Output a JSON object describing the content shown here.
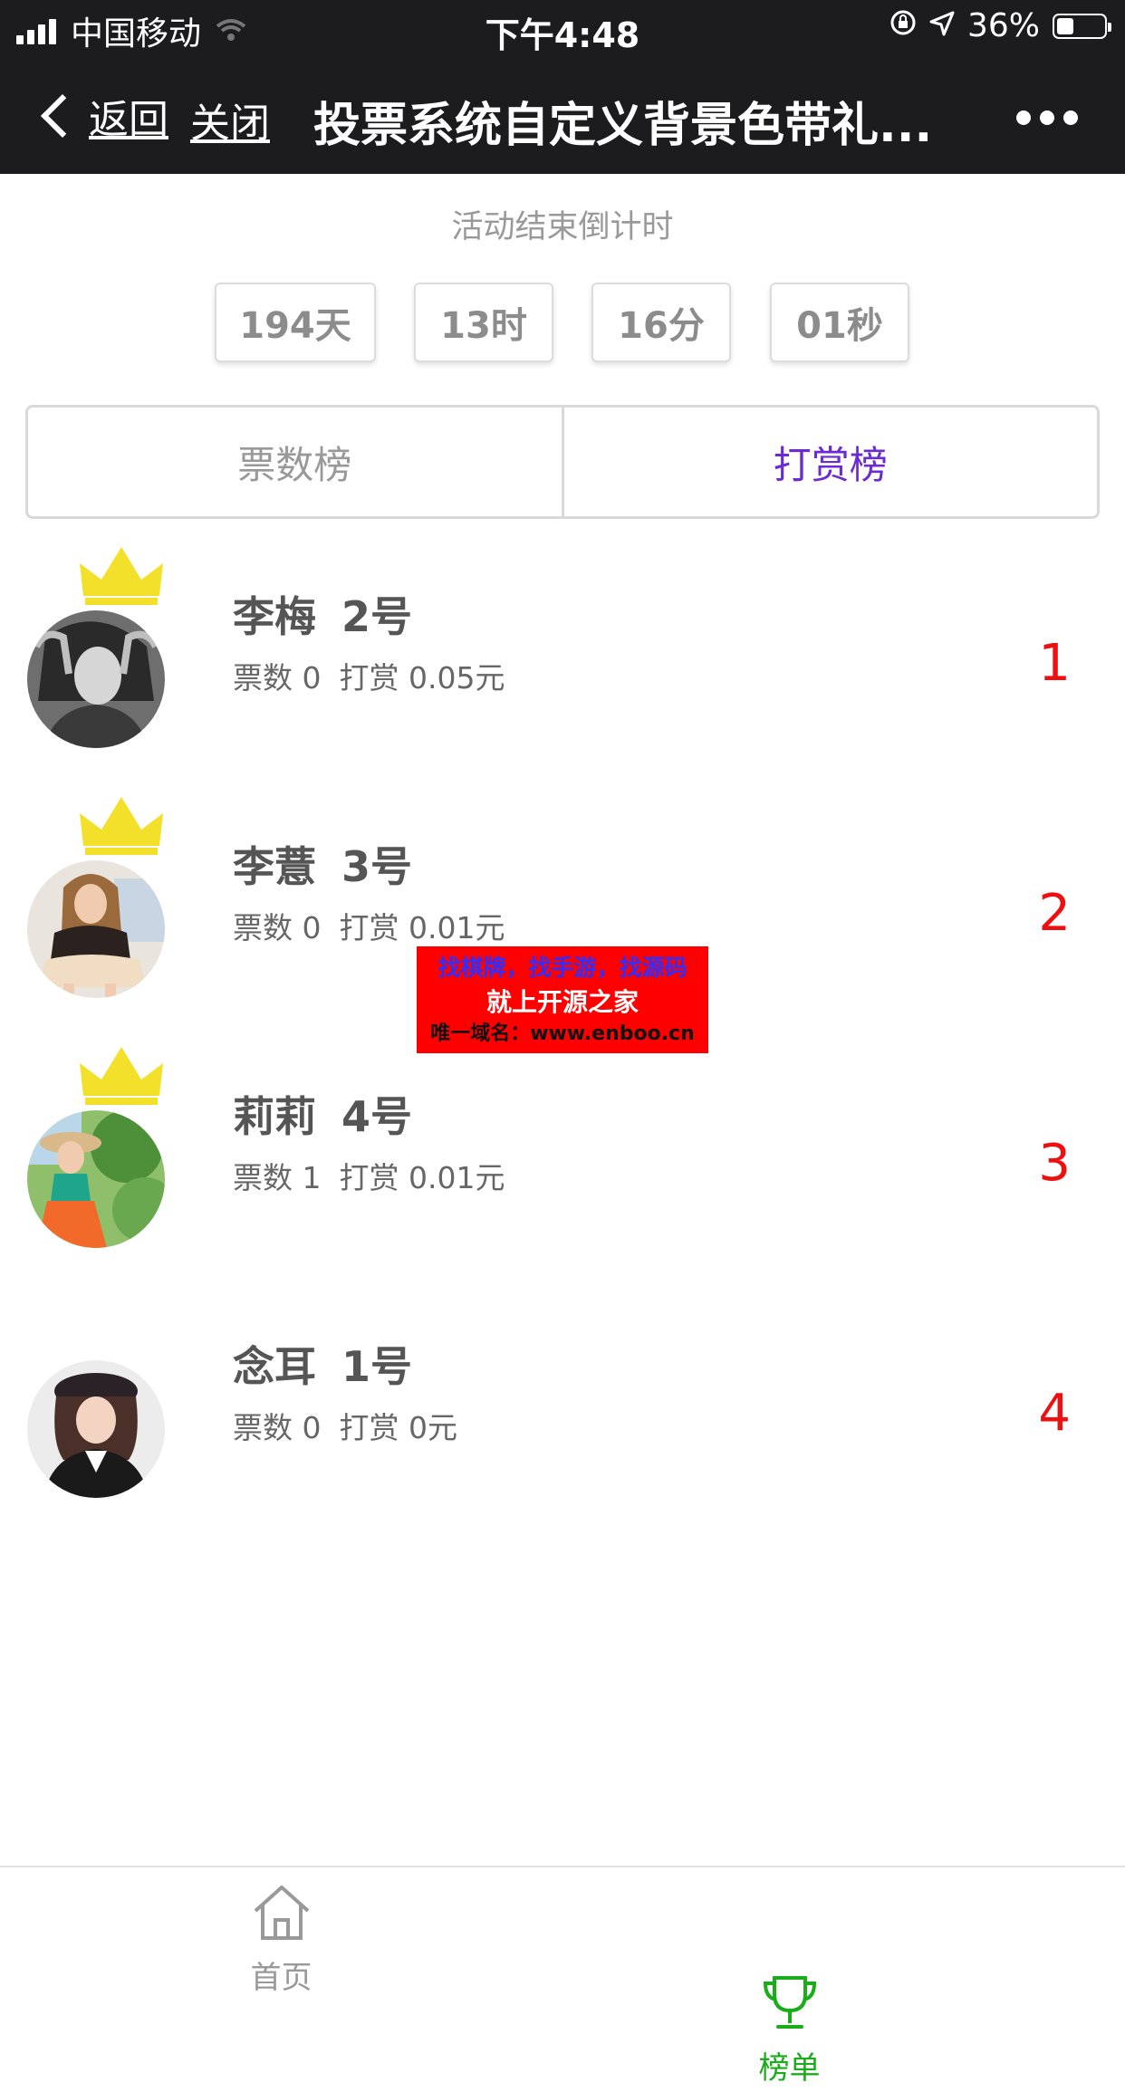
{
  "status_bar": {
    "carrier": "中国移动",
    "time": "下午4:48",
    "battery_text": "36%",
    "battery_level": 0.36
  },
  "nav": {
    "back_label": "返回",
    "close_label": "关闭",
    "title": "投票系统自定义背景色带礼..."
  },
  "countdown": {
    "label": "活动结束倒计时",
    "days": "194天",
    "hours": "13时",
    "minutes": "16分",
    "seconds": "01秒"
  },
  "tabs": [
    {
      "label": "票数榜",
      "active": false
    },
    {
      "label": "打赏榜",
      "active": true
    }
  ],
  "ranking": [
    {
      "name": "李梅",
      "number": "2号",
      "votes": "票数 0",
      "reward": "打赏 0.05元",
      "rank": "1",
      "crown": true
    },
    {
      "name": "李薏",
      "number": "3号",
      "votes": "票数 0",
      "reward": "打赏 0.01元",
      "rank": "2",
      "crown": true
    },
    {
      "name": "莉莉",
      "number": "4号",
      "votes": "票数 1",
      "reward": "打赏 0.01元",
      "rank": "3",
      "crown": true
    },
    {
      "name": "念耳",
      "number": "1号",
      "votes": "票数 0",
      "reward": "打赏 0元",
      "rank": "4",
      "crown": false
    }
  ],
  "watermark": {
    "line1": "找棋牌，找手游，找源码",
    "line2": "就上开源之家",
    "line3": "唯一域名：www.enboo.cn"
  },
  "tabbar": {
    "home_label": "首页",
    "rank_label": "榜单"
  },
  "colors": {
    "nav_bg": "#1c1c1e",
    "active_tab": "#6a2bd3",
    "rank_number": "#ee1010",
    "crown": "#f2e02a",
    "tabbar_active": "#1aad19"
  }
}
